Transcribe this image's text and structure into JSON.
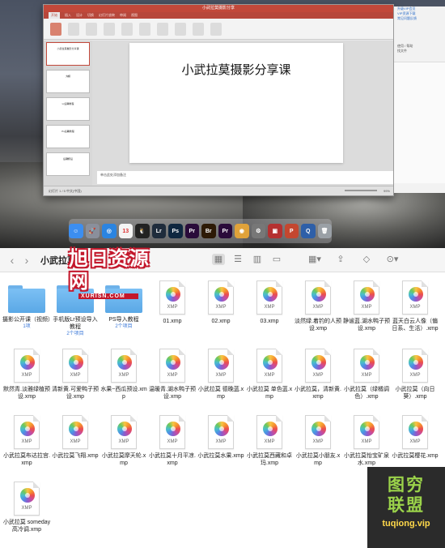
{
  "ppt": {
    "window_title": "小武拉莫摄影分享",
    "tabs": [
      "开始",
      "插入",
      "设计",
      "切换",
      "幻灯片放映",
      "审阅",
      "视图"
    ],
    "slide_title": "小武拉莫摄影分享课",
    "thumbnails": [
      {
        "num": "1",
        "text": "小武拉莫摄影分享课"
      },
      {
        "num": "2",
        "text": "大纲"
      },
      {
        "num": "3",
        "text": "Lr后期教程"
      },
      {
        "num": "4",
        "text": "Ps后期教程"
      },
      {
        "num": "5",
        "text": "后期预设"
      }
    ],
    "notes_placeholder": "单击此处添加备注",
    "status": "幻灯片 1 / 5    中文(中国)",
    "zoom": "99%"
  },
  "side_panel": {
    "items": [
      "升级VIP会员",
      "VIP资源下载",
      "常见问题反馈"
    ],
    "links": [
      "使用 / 帮助",
      "找文件"
    ]
  },
  "dock": {
    "icons": [
      {
        "name": "finder-icon",
        "glyph": "☺",
        "color": "#3c8ef0"
      },
      {
        "name": "launchpad-icon",
        "glyph": "🚀",
        "color": "#8a8f9b"
      },
      {
        "name": "safari-icon",
        "glyph": "◎",
        "color": "#2b84e0"
      },
      {
        "name": "calendar-icon",
        "glyph": "13",
        "color": "#f4f4f4"
      },
      {
        "name": "qq-icon",
        "glyph": "🐧",
        "color": "#222"
      },
      {
        "name": "lightroom-icon",
        "glyph": "Lr",
        "color": "#1f2c3c"
      },
      {
        "name": "photoshop-icon",
        "glyph": "Ps",
        "color": "#0f2740"
      },
      {
        "name": "premiere-icon",
        "glyph": "Pr",
        "color": "#2a0b3a"
      },
      {
        "name": "bridge-icon",
        "glyph": "Br",
        "color": "#2d1a06"
      },
      {
        "name": "premiere-icon-2",
        "glyph": "Pr",
        "color": "#2a0b3a"
      },
      {
        "name": "color-wheel-icon",
        "glyph": "◉",
        "color": "#e0a23a"
      },
      {
        "name": "system-preferences-icon",
        "glyph": "⚙",
        "color": "#777"
      },
      {
        "name": "photo-booth-icon",
        "glyph": "▣",
        "color": "#b53030"
      },
      {
        "name": "powerpoint-icon",
        "glyph": "P",
        "color": "#c4472f"
      },
      {
        "name": "quicktime-icon",
        "glyph": "Q",
        "color": "#2e5fa8"
      },
      {
        "name": "trash-icon",
        "glyph": "🗑",
        "color": "#9aa0a6"
      }
    ]
  },
  "finder": {
    "folder_title": "小武拉莫",
    "back_glyph": "‹",
    "forward_glyph": "›",
    "toolbar_icons": [
      {
        "name": "icon-view-icon",
        "glyph": "▦"
      },
      {
        "name": "list-view-icon",
        "glyph": "☰"
      },
      {
        "name": "column-view-icon",
        "glyph": "▥"
      },
      {
        "name": "gallery-view-icon",
        "glyph": "▭"
      }
    ],
    "toolbar_right": [
      {
        "name": "group-by-icon",
        "glyph": "▦▾"
      },
      {
        "name": "share-icon",
        "glyph": "⇪"
      },
      {
        "name": "tag-icon",
        "glyph": "◇"
      },
      {
        "name": "more-actions-icon",
        "glyph": "⊙▾"
      }
    ],
    "items": [
      {
        "type": "folder",
        "label": "摄影公开课（视频）",
        "sub": "1项"
      },
      {
        "type": "folder",
        "label": "手机版Lr预设导入教程",
        "sub": "2个项目"
      },
      {
        "type": "folder",
        "label": "PS导入教程",
        "sub": "2个项目"
      },
      {
        "type": "xmp",
        "label": "01.xmp"
      },
      {
        "type": "xmp",
        "label": "02.xmp"
      },
      {
        "type": "xmp",
        "label": "03.xmp"
      },
      {
        "type": "xmp",
        "label": "淡然绿.着钓的人预设.xmp"
      },
      {
        "type": "xmp",
        "label": "静谧蓝.湖水鸭子预设.xmp"
      },
      {
        "type": "xmp",
        "label": "蓝天白云人像（偏日系、生活）.xmp"
      },
      {
        "type": "xmp",
        "label": "默然青.淡雅绿植预设.xmp"
      },
      {
        "type": "xmp",
        "label": "清新黄.可爱鸭子预设.xmp"
      },
      {
        "type": "xmp",
        "label": "水果~西瓜预设.xmp"
      },
      {
        "type": "xmp",
        "label": "温暖青.湖水鸭子预设.xmp"
      },
      {
        "type": "xmp",
        "label": "小武拉莫 德晚蓝.xmp"
      },
      {
        "type": "xmp",
        "label": "小武拉莫 单色蓝.xmp"
      },
      {
        "type": "xmp",
        "label": "小武拉莫，清新黄.xmp"
      },
      {
        "type": "xmp",
        "label": "小武拉莫（绿橘调色）.xmp"
      },
      {
        "type": "xmp",
        "label": "小武拉莫（向日葵）.xmp"
      },
      {
        "type": "xmp",
        "label": "小武拉莫布达拉宫.xmp"
      },
      {
        "type": "xmp",
        "label": "小武拉莫飞翔.xmp"
      },
      {
        "type": "xmp",
        "label": "小武拉莫摩天轮.xmp"
      },
      {
        "type": "xmp",
        "label": "小武拉莫十月平凉.xmp"
      },
      {
        "type": "xmp",
        "label": "小武拉莫水果.xmp"
      },
      {
        "type": "xmp",
        "label": "小武拉莫西藏和卓玛.xmp"
      },
      {
        "type": "xmp",
        "label": "小武拉莫小朋友.xmp"
      },
      {
        "type": "xmp",
        "label": "小武拉莫怡宝矿泉水.xmp"
      },
      {
        "type": "xmp",
        "label": "小武拉莫樱花.xmp"
      },
      {
        "type": "xmp",
        "label": "小武拉莫 someday 高冷调.xmp"
      }
    ],
    "xmp_ext": "XMP"
  },
  "watermarks": {
    "logo_main": "旭日资源网",
    "logo_sub": "XURISN.COM",
    "badge_text_1": "图穷",
    "badge_text_2": "联盟",
    "badge_url": "tuqiong.vip"
  }
}
